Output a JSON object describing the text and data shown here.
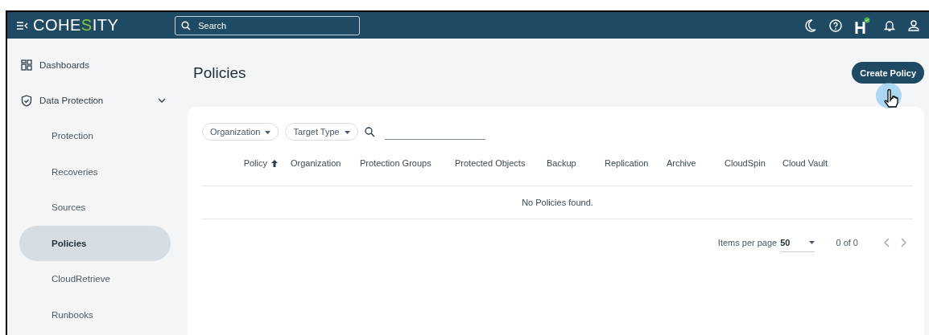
{
  "header": {
    "logo": [
      {
        "text": "COHE",
        "accent": false
      },
      {
        "text": "S",
        "accent": true
      },
      {
        "text": "ITY",
        "accent": false
      }
    ],
    "search": {
      "placeholder": "Search"
    }
  },
  "sidebar": {
    "items": [
      {
        "label": "Dashboards",
        "kind": "top",
        "selected": false
      },
      {
        "label": "Data Protection",
        "kind": "group",
        "selected": false,
        "expanded": true,
        "children": [
          {
            "label": "Protection",
            "selected": false
          },
          {
            "label": "Recoveries",
            "selected": false
          },
          {
            "label": "Sources",
            "selected": false
          },
          {
            "label": "Policies",
            "selected": true
          },
          {
            "label": "CloudRetrieve",
            "selected": false
          },
          {
            "label": "Runbooks",
            "selected": false
          }
        ]
      }
    ]
  },
  "page": {
    "title": "Policies",
    "create_button": "Create Policy"
  },
  "filters": [
    "Organization",
    "Target Type"
  ],
  "table": {
    "columns": [
      {
        "label": "Policy",
        "sorted": true
      },
      {
        "label": "Organization",
        "sorted": false
      },
      {
        "label": "Protection Groups",
        "sorted": false
      },
      {
        "label": "Protected Objects",
        "sorted": false
      },
      {
        "label": "Backup",
        "sorted": false
      },
      {
        "label": "Replication",
        "sorted": false
      },
      {
        "label": "Archive",
        "sorted": false
      },
      {
        "label": "CloudSpin",
        "sorted": false
      },
      {
        "label": "Cloud Vault",
        "sorted": false
      }
    ],
    "empty_message": "No Policies found."
  },
  "pagination": {
    "label": "Items per page",
    "page_size": "50",
    "range": "0 of 0"
  }
}
